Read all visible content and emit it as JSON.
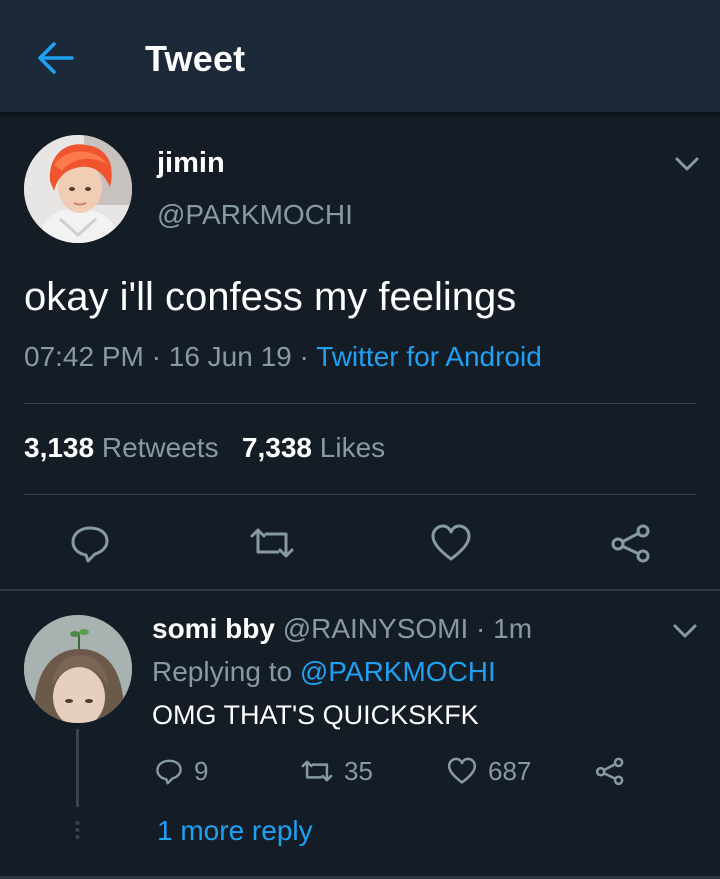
{
  "header": {
    "title": "Tweet",
    "back_icon": "back-arrow-icon",
    "accent": "#1da1f2"
  },
  "tweet": {
    "author_name": "jimin",
    "author_handle": "@PARKMOCHI",
    "text": "okay i'll confess my feelings",
    "time": "07:42 PM",
    "date": "16 Jun 19",
    "separator": "·",
    "client": "Twitter for Android",
    "retweets_count": "3,138",
    "retweets_label": "Retweets",
    "likes_count": "7,338",
    "likes_label": "Likes",
    "actions": [
      "reply-icon",
      "retweet-icon",
      "heart-icon",
      "share-icon"
    ]
  },
  "reply": {
    "name": "somi bby",
    "handle": "@RAINYSOMI",
    "time": "1m",
    "replying_label": "Replying to",
    "replying_to": "@PARKMOCHI",
    "text": "OMG THAT'S QUICKSKFK",
    "reply_count": "9",
    "retweet_count": "35",
    "like_count": "687"
  },
  "thread": {
    "more_replies": "1 more reply"
  },
  "colors": {
    "background": "#141d26",
    "header": "#1c2938",
    "muted": "#8899a6",
    "link": "#1da1f2",
    "divider": "#38444d"
  }
}
